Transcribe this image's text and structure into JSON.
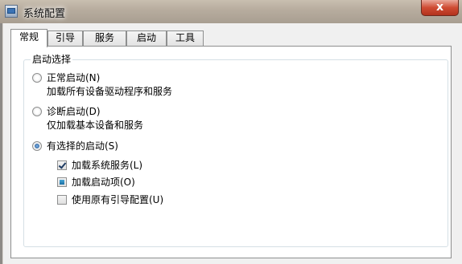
{
  "window": {
    "title": "系统配置",
    "close_label": "x"
  },
  "tabs": [
    {
      "label": "常规",
      "active": true
    },
    {
      "label": "引导",
      "active": false
    },
    {
      "label": "服务",
      "active": false
    },
    {
      "label": "启动",
      "active": false
    },
    {
      "label": "工具",
      "active": false
    }
  ],
  "general": {
    "group_title": "启动选择",
    "options": [
      {
        "label": "正常启动(N)",
        "description": "加载所有设备驱动程序和服务",
        "selected": false
      },
      {
        "label": "诊断启动(D)",
        "description": "仅加载基本设备和服务",
        "selected": false
      },
      {
        "label": "有选择的启动(S)",
        "selected": true
      }
    ],
    "selective": [
      {
        "label": "加载系统服务(L)",
        "state": "checked"
      },
      {
        "label": "加载启动项(O)",
        "state": "indeterminate"
      },
      {
        "label": "使用原有引导配置(U)",
        "state": "unchecked"
      }
    ]
  }
}
